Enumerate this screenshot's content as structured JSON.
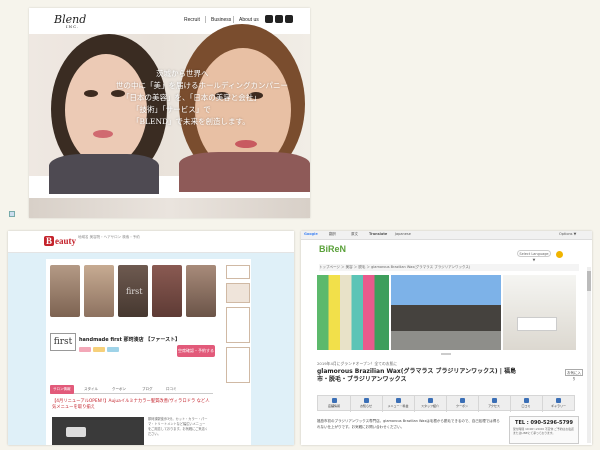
{
  "blend": {
    "logo": "Blend",
    "logo_sub": "INC.",
    "nav": [
      "Recruit",
      "Business",
      "About us"
    ],
    "hero_lines": [
      "茨城から世界へ",
      "世の中に「美」を届けるホールディングカンパニー",
      "「日本の美容」を、「日本の美容と会社」",
      "「技術」「サービス」で",
      "「BLEND」で未来を創造します。"
    ]
  },
  "beauty": {
    "logo_mark": "B",
    "logo_text": "eauty",
    "header_small": "地域名 美容院・ヘアサロン 検索・予約",
    "photo_label": "first",
    "salon_logo": "first",
    "salon_name": "handmade first 那珂湊店 【ファースト】",
    "reserve_label": "空席確認・予約する",
    "tabs": [
      "サロン情報",
      "スタイル",
      "クーポン",
      "ブログ",
      "口コミ"
    ],
    "promo": "【4月リニューアルOPEN!!】Aujuaイルミナカラー髪質改善/ヴィラロドラ など人気メニューを取り揃え",
    "desc": "那珂湊駅徒歩3分。カット・カラー・パーマ・トリートメントなど幅広いメニューをご用意しております。お気軽にご来店ください。"
  },
  "brazil": {
    "google_bar": [
      "Google",
      "翻訳",
      "原文",
      "Translate",
      "Japanese",
      "Options ▼"
    ],
    "logo": "BiReN",
    "language": "Select Language ▼",
    "breadcrumb": "トップページ ＞ 美容 ＞ 脱毛 ＞ glamorous Brazilian Wax(グラマラス ブラジリアンワックス)",
    "date": "2019年4月にグランドオープン！全てのお肌に",
    "title": "glamorous Brazilian Wax(グラマラス ブラジリアンワックス) | 福島市・脱毛・ブラジリアンワックス",
    "share": "お気に入り",
    "icons": [
      "店舗情報",
      "お知らせ",
      "メニュー・料金",
      "スタッフ紹介",
      "クーポン",
      "アクセス",
      "口コミ",
      "ギャラリー"
    ],
    "body": "福島市初のブラジリアンワックス専門店。glamorous Brazilian Waxは毛根から脱毛できるので、自己処理では得られない仕上がりです。お気軽にお問い合わせください。",
    "tel": "TEL : 090-5296-5799",
    "tel_note": "受付時間 10:00〜20:00 不定休 ご予約はお電話またはLINEにて承っております。"
  }
}
